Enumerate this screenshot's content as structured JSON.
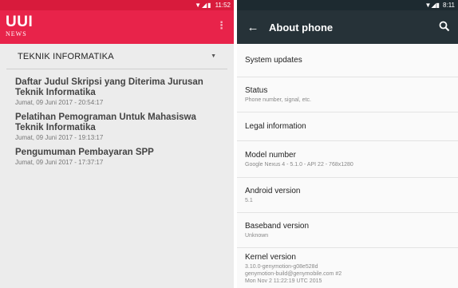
{
  "left": {
    "status_time": "11:52",
    "logo": {
      "main": "UUI",
      "sub": "NEWS"
    },
    "menu_glyph": "⋮",
    "category": "TEKNIK INFORMATIKA",
    "news": [
      {
        "title": "Daftar Judul Skripsi yang Diterima Jurusan Teknik Informatika",
        "date": "Jumat, 09 Juni 2017 - 20:54:17"
      },
      {
        "title": "Pelatihan Pemograman Untuk Mahasiswa Teknik Informatika",
        "date": "Jumat, 09 Juni 2017 - 19:13:17"
      },
      {
        "title": "Pengumuman Pembayaran SPP",
        "date": "Jumat, 09 Juni 2017 - 17:37:17"
      }
    ]
  },
  "right": {
    "status_time": "8:11",
    "title": "About phone",
    "settings": [
      {
        "title": "System updates",
        "subtitle": ""
      },
      {
        "title": "Status",
        "subtitle": "Phone number, signal, etc."
      },
      {
        "title": "Legal information",
        "subtitle": ""
      },
      {
        "title": "Model number",
        "subtitle": "Google Nexus 4 - 5.1.0 - API 22 - 768x1280"
      },
      {
        "title": "Android version",
        "subtitle": "5.1"
      },
      {
        "title": "Baseband version",
        "subtitle": "Unknown"
      },
      {
        "title": "Kernel version",
        "subtitle": "3.10.0-genymotion-g08e528d\ngenymotion-build@genymobile.com #2\nMon Nov 2 11:22:19 UTC 2015"
      }
    ]
  },
  "colors": {
    "left_appbar": "#e8234a",
    "left_status": "#d81b3c",
    "right_appbar": "#263238",
    "right_status": "#1d2a30"
  },
  "icons": [
    "wifi-icon",
    "signal-icon",
    "battery-icon",
    "overflow-menu-icon",
    "dropdown-caret-icon",
    "back-arrow-icon",
    "search-icon"
  ]
}
